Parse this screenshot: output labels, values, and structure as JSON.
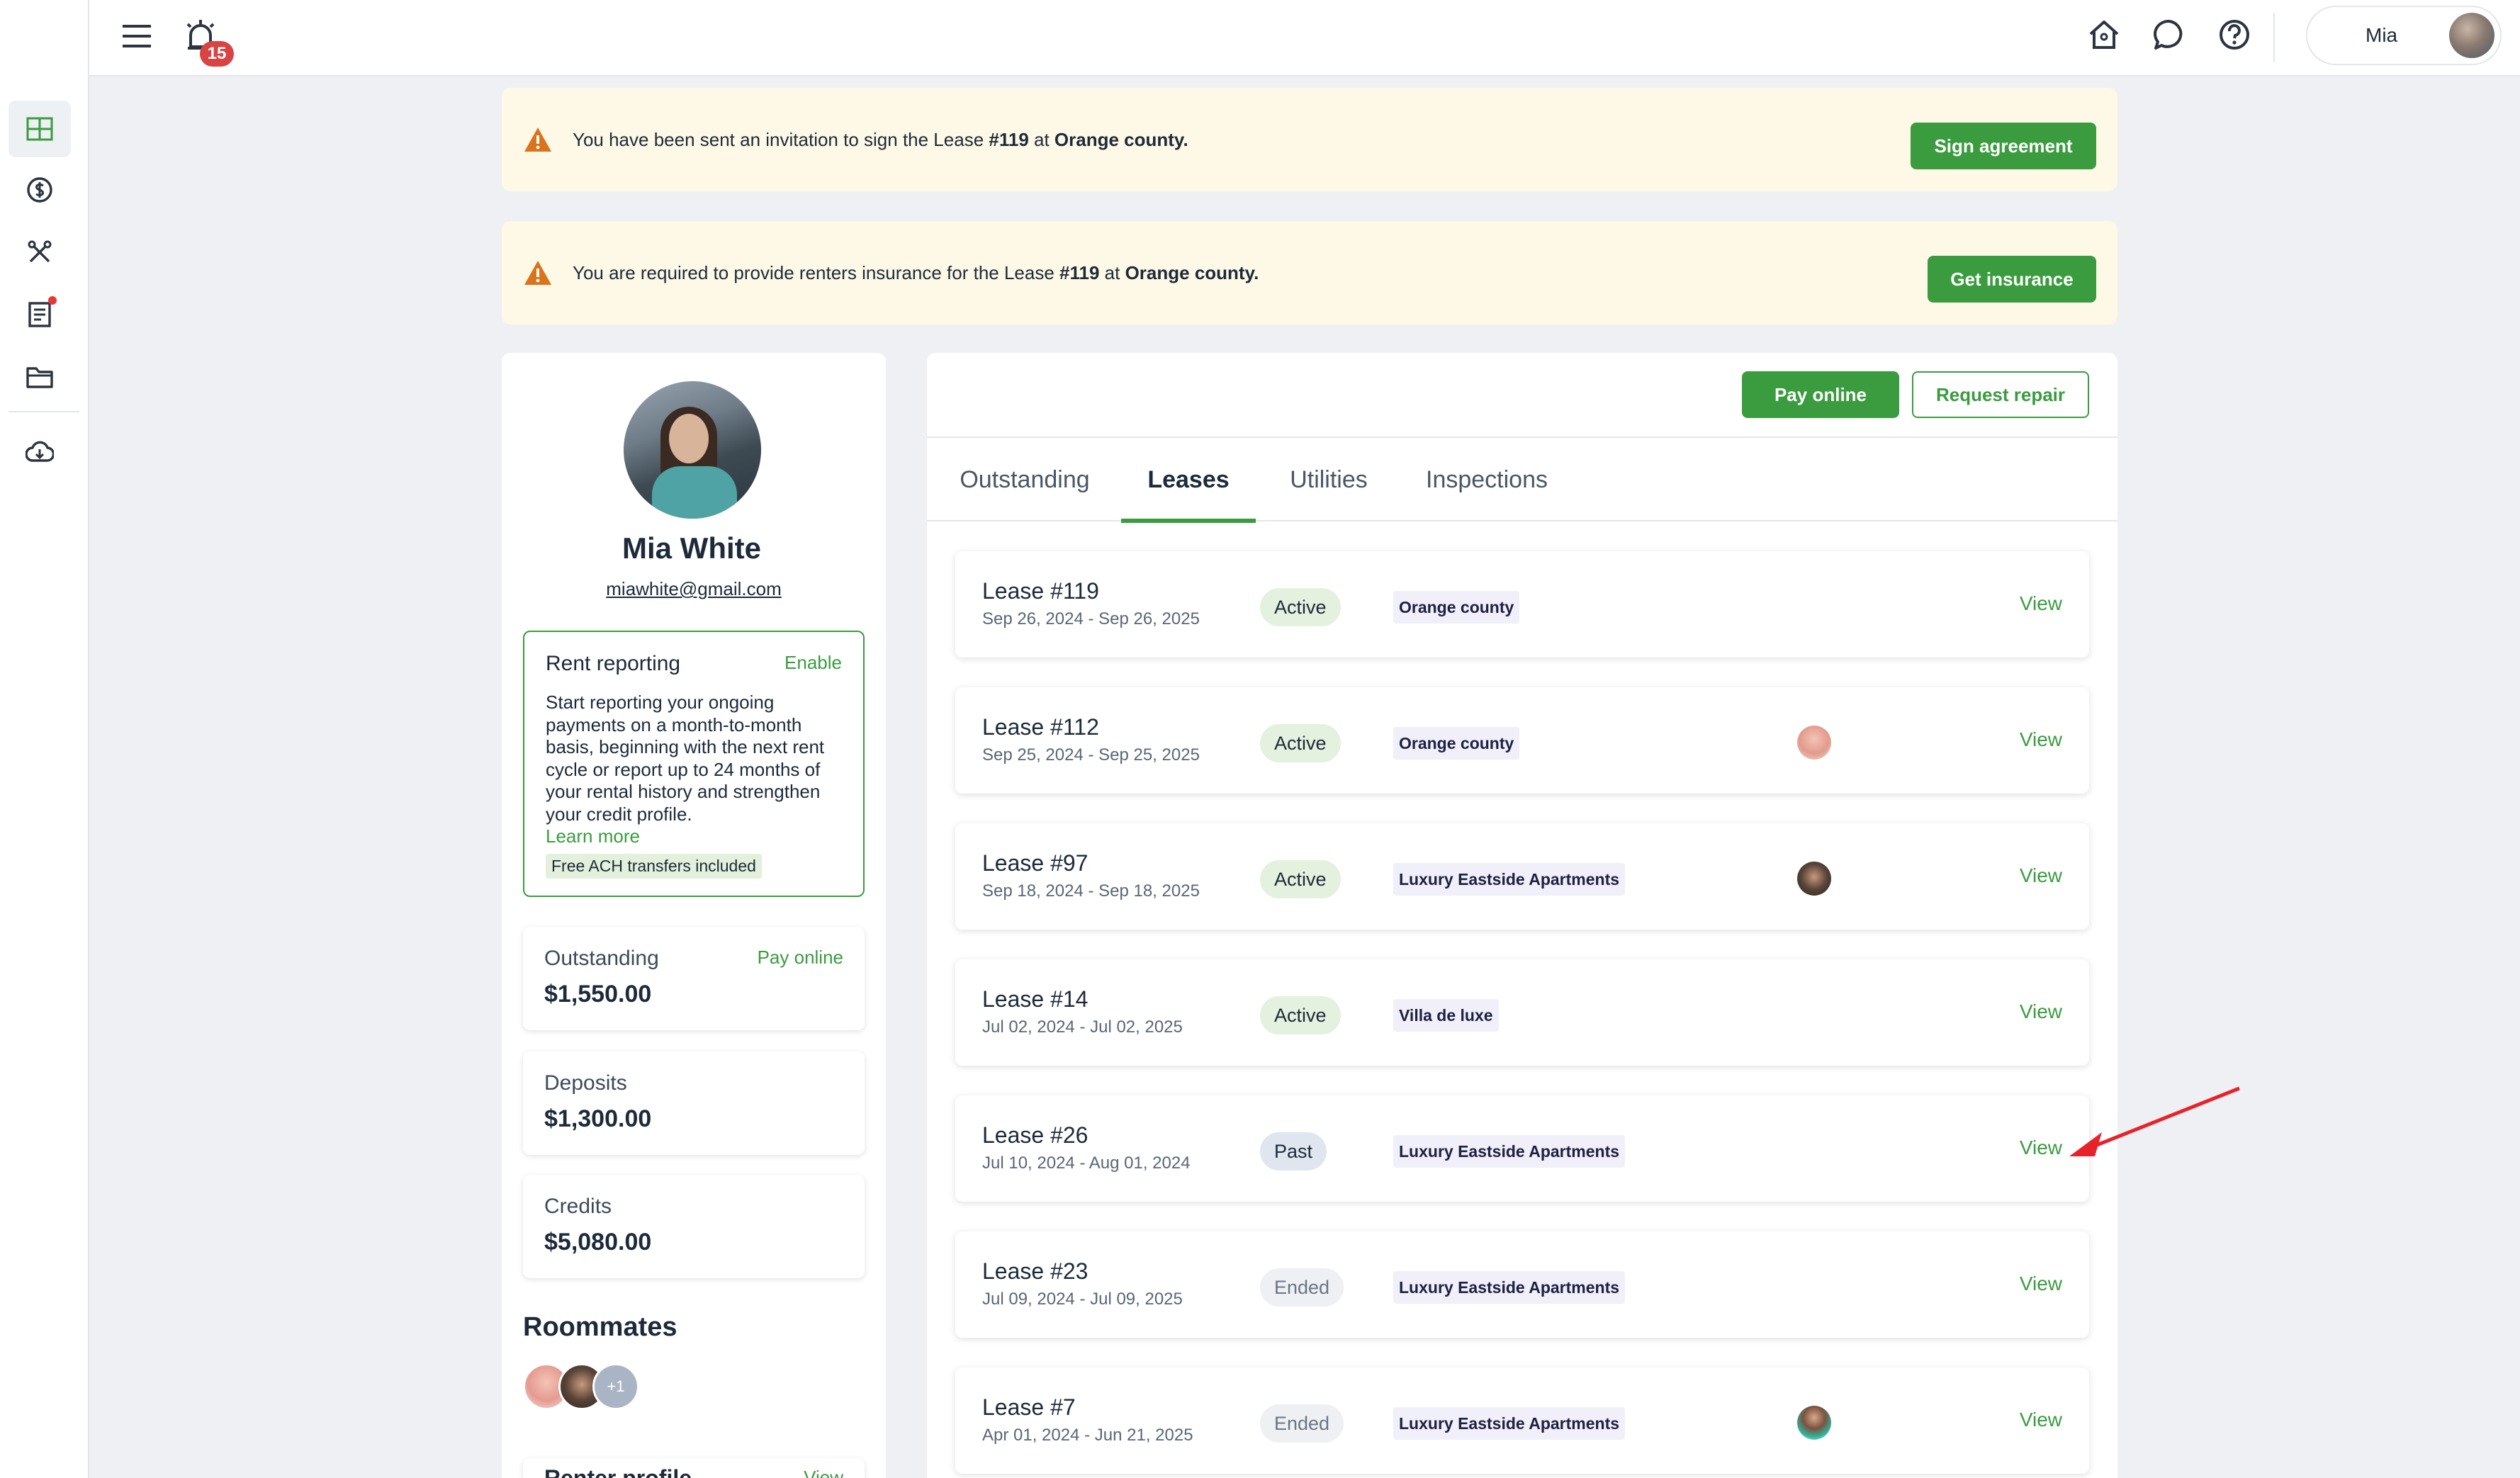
{
  "topbar": {
    "notification_count": "15",
    "user_name": "Mia"
  },
  "alerts": [
    {
      "pre": "You have been sent an invitation to sign the Lease ",
      "lease": "#119",
      "mid": " at ",
      "place": "Orange county.",
      "button": "Sign agreement"
    },
    {
      "pre": "You are required to provide renters insurance for the Lease ",
      "lease": "#119",
      "mid": " at ",
      "place": "Orange county.",
      "button": "Get insurance"
    }
  ],
  "profile": {
    "name": "Mia White",
    "email": "miawhite@gmail.com",
    "rent_reporting": {
      "title": "Rent reporting",
      "action": "Enable",
      "description": "Start reporting your ongoing payments on a month-to-month basis, beginning with the next rent cycle or report up to 24 months of your rental history and strengthen your credit profile.",
      "learn_more": "Learn more",
      "tag": "Free ACH transfers included"
    },
    "outstanding": {
      "label": "Outstanding",
      "value": "$1,550.00",
      "action": "Pay online"
    },
    "deposits": {
      "label": "Deposits",
      "value": "$1,300.00"
    },
    "credits": {
      "label": "Credits",
      "value": "$5,080.00"
    },
    "roommates_title": "Roommates",
    "roommates_more": "+1",
    "renter_profile": {
      "label": "Renter profile",
      "action": "View"
    }
  },
  "leases_panel": {
    "pay_online": "Pay online",
    "request_repair": "Request repair",
    "tabs": [
      "Outstanding",
      "Leases",
      "Utilities",
      "Inspections"
    ],
    "active_tab": "Leases",
    "view_label": "View",
    "leases": [
      {
        "name": "Lease #119",
        "dates": "Sep 26, 2024 - Sep 26, 2025",
        "status": "Active",
        "property": "Orange county",
        "avatar": false
      },
      {
        "name": "Lease #112",
        "dates": "Sep 25, 2024 - Sep 25, 2025",
        "status": "Active",
        "property": "Orange county",
        "avatar": true
      },
      {
        "name": "Lease #97",
        "dates": "Sep 18, 2024 - Sep 18, 2025",
        "status": "Active",
        "property": "Luxury Eastside Apartments",
        "avatar": true
      },
      {
        "name": "Lease #14",
        "dates": "Jul 02, 2024 - Jul 02, 2025",
        "status": "Active",
        "property": "Villa de luxe",
        "avatar": false
      },
      {
        "name": "Lease #26",
        "dates": "Jul 10, 2024 - Aug 01, 2024",
        "status": "Past",
        "property": "Luxury Eastside Apartments",
        "avatar": false
      },
      {
        "name": "Lease #23",
        "dates": "Jul 09, 2024 - Jul 09, 2025",
        "status": "Ended",
        "property": "Luxury Eastside Apartments",
        "avatar": false
      },
      {
        "name": "Lease #7",
        "dates": "Apr 01, 2024 - Jun 21, 2025",
        "status": "Ended",
        "property": "Luxury Eastside Apartments",
        "avatar": true
      }
    ]
  },
  "colors": {
    "accent_green": "#3a9c3f",
    "alert_bg": "#fdf9e6",
    "warning_orange": "#d9731c",
    "badge_red": "#d84343",
    "annotation_arrow": "#e8222a"
  },
  "icons": {
    "topbar": [
      "menu-icon",
      "alarm-icon",
      "home-icon",
      "chat-icon",
      "help-icon"
    ],
    "sidebar": [
      "dashboard-icon",
      "dollar-icon",
      "tools-icon",
      "document-icon",
      "folder-icon",
      "download-icon"
    ],
    "alert": "warning-icon"
  }
}
